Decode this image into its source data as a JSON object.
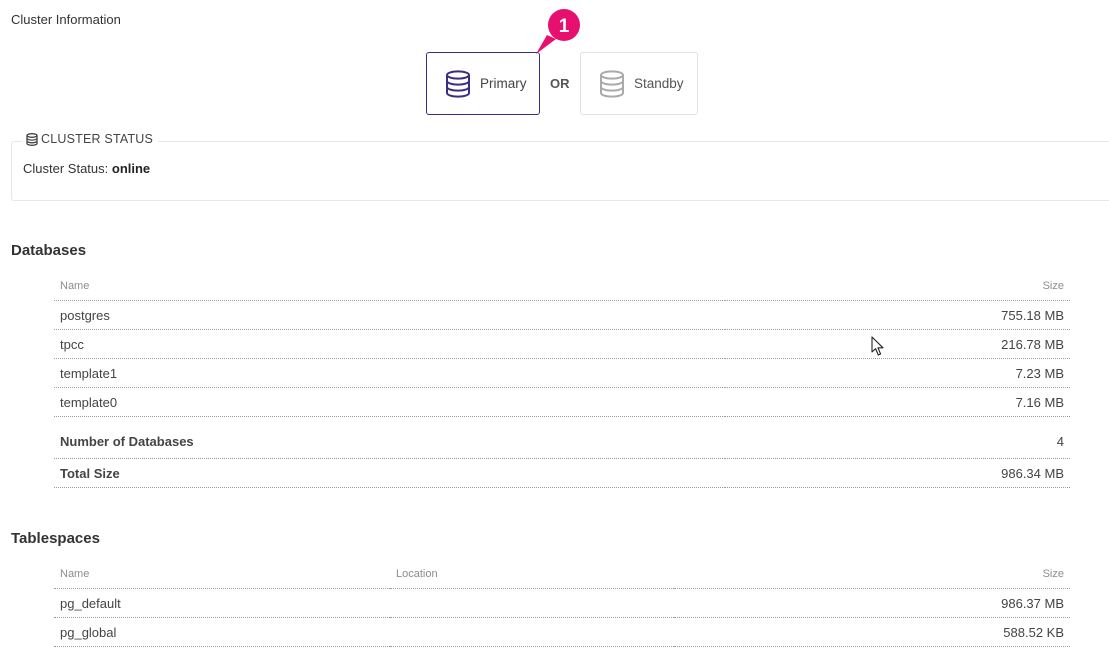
{
  "page": {
    "title": "Cluster Information"
  },
  "role_selector": {
    "primary_label": "Primary",
    "separator": "OR",
    "standby_label": "Standby",
    "callout_number": "1",
    "active_color": "#3c2d84",
    "callout_color": "#e8106e"
  },
  "cluster_status": {
    "legend": "CLUSTER STATUS",
    "label": "Cluster Status:",
    "value": "online"
  },
  "databases": {
    "title": "Databases",
    "columns": {
      "name": "Name",
      "size": "Size"
    },
    "rows": [
      {
        "name": "postgres",
        "size": "755.18 MB"
      },
      {
        "name": "tpcc",
        "size": "216.78 MB"
      },
      {
        "name": "template1",
        "size": "7.23 MB"
      },
      {
        "name": "template0",
        "size": "7.16 MB"
      }
    ],
    "summary": [
      {
        "label": "Number of Databases",
        "value": "4"
      },
      {
        "label": "Total Size",
        "value": "986.34 MB"
      }
    ]
  },
  "tablespaces": {
    "title": "Tablespaces",
    "columns": {
      "name": "Name",
      "location": "Location",
      "size": "Size"
    },
    "rows": [
      {
        "name": "pg_default",
        "location": "",
        "size": "986.37 MB"
      },
      {
        "name": "pg_global",
        "location": "",
        "size": "588.52 KB"
      }
    ]
  }
}
